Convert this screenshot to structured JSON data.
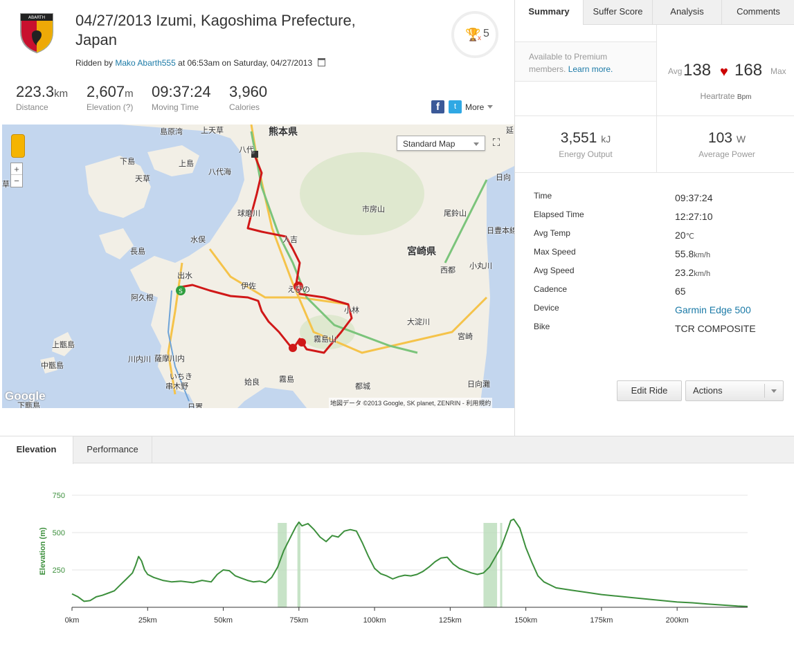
{
  "ride": {
    "title_line1": "04/27/2013 Izumi, Kagoshima Prefecture,",
    "title_line2": "Japan",
    "ridden_by": "Ridden by",
    "athlete": "Mako Abarth555",
    "at": "at",
    "time": "06:53am",
    "on": "on",
    "date": "Saturday, 04/27/2013",
    "logo_text": "ABARTH"
  },
  "achievements": {
    "x": "x",
    "count": "5"
  },
  "stats": [
    {
      "value": "223.3",
      "unit": "km",
      "label": "Distance"
    },
    {
      "value": "2,607",
      "unit": "m",
      "label": "Elevation (?)"
    },
    {
      "value": "09:37:24",
      "unit": "",
      "label": "Moving Time"
    },
    {
      "value": "3,960",
      "unit": "",
      "label": "Calories"
    }
  ],
  "social": {
    "fb": "f",
    "tw": "t",
    "more": "More"
  },
  "map": {
    "type_select": "Standard Map",
    "zoom_in": "+",
    "zoom_out": "−",
    "google": "Google",
    "copyright": "地図データ ©2013 Google, SK planet, ZENRIN - 利用規約",
    "labels": [
      {
        "text": "熊本県",
        "big": true
      },
      {
        "text": "島原湾"
      },
      {
        "text": "上天草"
      },
      {
        "text": "八代"
      },
      {
        "text": "下島"
      },
      {
        "text": "上島"
      },
      {
        "text": "八代海"
      },
      {
        "text": "天草"
      },
      {
        "text": "球磨川"
      },
      {
        "text": "水俣"
      },
      {
        "text": "人吉"
      },
      {
        "text": "長島"
      },
      {
        "text": "出水"
      },
      {
        "text": "伊佐"
      },
      {
        "text": "えびの"
      },
      {
        "text": "阿久根"
      },
      {
        "text": "小林"
      },
      {
        "text": "宮崎県",
        "big": true
      },
      {
        "text": "市房山"
      },
      {
        "text": "尾鈴山"
      },
      {
        "text": "西都"
      },
      {
        "text": "小丸川"
      },
      {
        "text": "大淀川"
      },
      {
        "text": "宮崎"
      },
      {
        "text": "上甑島"
      },
      {
        "text": "中甑島"
      },
      {
        "text": "川内川"
      },
      {
        "text": "薩摩川内"
      },
      {
        "text": "いちき"
      },
      {
        "text": "串木野"
      },
      {
        "text": "姶良"
      },
      {
        "text": "霧島"
      },
      {
        "text": "都城"
      },
      {
        "text": "日向灘"
      },
      {
        "text": "日向"
      },
      {
        "text": "霧島山"
      },
      {
        "text": "日豊本線"
      },
      {
        "text": "延"
      },
      {
        "text": "草"
      },
      {
        "text": "下甑島"
      },
      {
        "text": "日置"
      }
    ],
    "markers": {
      "start": "S",
      "lap": "4"
    }
  },
  "tabs": [
    "Summary",
    "Suffer Score",
    "Analysis",
    "Comments"
  ],
  "premium": {
    "text": "Available to Premium members.",
    "link": "Learn more."
  },
  "heartrate": {
    "avg_label": "Avg",
    "avg": "138",
    "max": "168",
    "max_label": "Max",
    "label": "Heartrate",
    "unit": "Bpm"
  },
  "energy": {
    "value": "3,551",
    "unit": "kJ",
    "label": "Energy Output"
  },
  "power": {
    "value": "103",
    "unit": "W",
    "label": "Average Power"
  },
  "details": [
    {
      "key": "Time",
      "value": "09:37:24",
      "unit": ""
    },
    {
      "key": "Elapsed Time",
      "value": "12:27:10",
      "unit": ""
    },
    {
      "key": "Avg Temp",
      "value": "20",
      "unit": "℃"
    },
    {
      "key": "Max Speed",
      "value": "55.8",
      "unit": "km/h"
    },
    {
      "key": "Avg Speed",
      "value": "23.2",
      "unit": "km/h"
    },
    {
      "key": "Cadence",
      "value": "65",
      "unit": ""
    },
    {
      "key": "Device",
      "value": "Garmin Edge 500",
      "unit": "",
      "link": true
    },
    {
      "key": "Bike",
      "value": "TCR COMPOSITE",
      "unit": ""
    }
  ],
  "buttons": {
    "edit": "Edit Ride",
    "actions": "Actions"
  },
  "bottom_tabs": [
    "Elevation",
    "Performance"
  ],
  "colors": {
    "link": "#1b7aa7",
    "route": "#d01818",
    "elevation": "#3c8f3c",
    "heart": "#cc0000"
  },
  "chart_data": {
    "type": "area",
    "ylabel": "Elevation (m)",
    "xlabel": "",
    "xlim": [
      0,
      223.3
    ],
    "ylim": [
      0,
      750
    ],
    "yticks": [
      250,
      500,
      750
    ],
    "xticks": [
      {
        "v": 0,
        "label": "0km"
      },
      {
        "v": 25,
        "label": "25km"
      },
      {
        "v": 50,
        "label": "50km"
      },
      {
        "v": 75,
        "label": "75km"
      },
      {
        "v": 100,
        "label": "100km"
      },
      {
        "v": 125,
        "label": "125km"
      },
      {
        "v": 150,
        "label": "150km"
      },
      {
        "v": 175,
        "label": "175km"
      },
      {
        "v": 200,
        "label": "200km"
      }
    ],
    "grid": true,
    "series": [
      {
        "x": [
          0,
          2,
          4,
          6,
          8,
          10,
          12,
          14,
          16,
          18,
          20,
          21,
          22,
          23,
          24,
          25,
          27,
          30,
          33,
          36,
          40,
          43,
          46,
          48,
          50,
          52,
          54,
          56,
          58,
          60,
          62,
          64,
          66,
          68,
          70,
          72,
          74,
          75,
          76,
          78,
          80,
          82,
          84,
          86,
          88,
          90,
          92,
          94,
          96,
          98,
          100,
          102,
          104,
          106,
          108,
          110,
          112,
          114,
          116,
          118,
          120,
          122,
          124,
          126,
          128,
          130,
          132,
          134,
          136,
          138,
          140,
          142,
          144,
          145,
          146,
          148,
          150,
          152,
          154,
          156,
          158,
          160,
          165,
          170,
          175,
          180,
          185,
          190,
          195,
          200,
          205,
          210,
          215,
          220,
          223.3
        ],
        "y": [
          90,
          70,
          40,
          45,
          70,
          80,
          95,
          110,
          150,
          190,
          230,
          280,
          340,
          310,
          250,
          220,
          200,
          180,
          170,
          175,
          165,
          180,
          170,
          220,
          250,
          245,
          210,
          195,
          180,
          170,
          175,
          165,
          200,
          270,
          380,
          460,
          540,
          570,
          545,
          560,
          520,
          470,
          440,
          480,
          470,
          510,
          520,
          510,
          430,
          340,
          260,
          225,
          210,
          190,
          205,
          215,
          210,
          220,
          240,
          270,
          305,
          330,
          335,
          290,
          260,
          245,
          230,
          220,
          230,
          270,
          340,
          410,
          520,
          580,
          590,
          530,
          400,
          300,
          210,
          170,
          150,
          130,
          115,
          100,
          85,
          75,
          65,
          55,
          45,
          35,
          30,
          22,
          15,
          8,
          5
        ]
      }
    ],
    "highlights": [
      [
        68,
        71
      ],
      [
        74.5,
        75.5
      ],
      [
        136,
        140.5
      ],
      [
        141.5,
        142.2
      ]
    ]
  }
}
